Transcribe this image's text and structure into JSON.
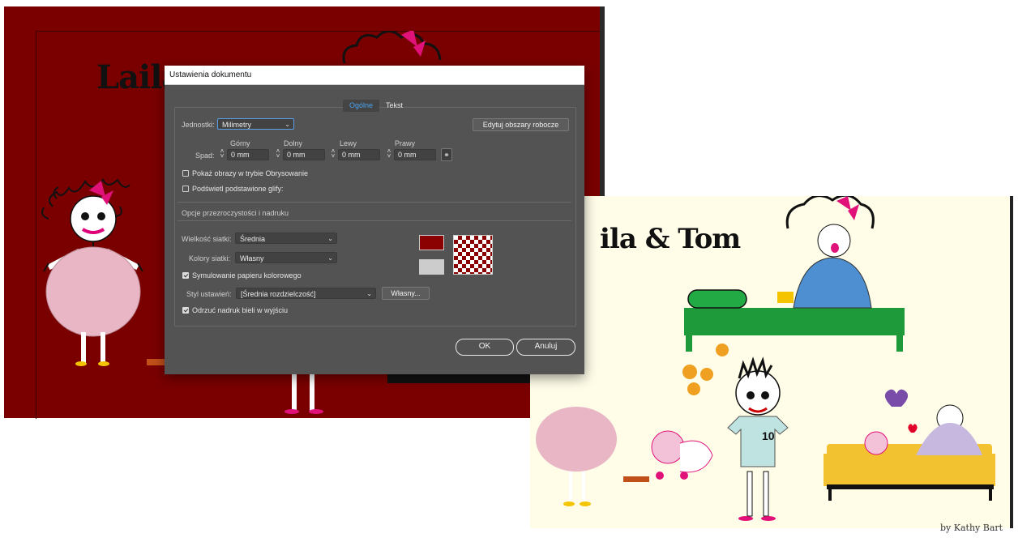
{
  "background": {
    "left_title": "Laila",
    "right_title": "ila & Tom",
    "credit": "by Kathy Bart",
    "jersey_number": "10",
    "colors": {
      "red_artboard": "#7a0000",
      "cream_artboard": "#fffde8"
    }
  },
  "dialog": {
    "title": "Ustawienia dokumentu",
    "tabs": [
      {
        "label": "Ogólne",
        "active": true
      },
      {
        "label": "Tekst",
        "active": false
      }
    ],
    "units_label": "Jednostki:",
    "units_value": "Milimetry",
    "edit_artboards_label": "Edytuj obszary robocze",
    "bleed": {
      "label": "Spad:",
      "fields": [
        {
          "label": "Górny",
          "value": "0 mm"
        },
        {
          "label": "Dolny",
          "value": "0 mm"
        },
        {
          "label": "Lewy",
          "value": "0 mm"
        },
        {
          "label": "Prawy",
          "value": "0 mm"
        }
      ]
    },
    "checkboxes": {
      "show_images_outline": {
        "label": "Pokaż obrazy w trybie Obrysowanie",
        "checked": false
      },
      "highlight_glyphs": {
        "label": "Podświetl podstawione glify:",
        "checked": false
      }
    },
    "transparency_section": "Opcje przezroczystości i nadruku",
    "grid_size_label": "Wielkość siatki:",
    "grid_size_value": "Średnia",
    "grid_colors_label": "Kolory siatki:",
    "grid_colors_value": "Własny",
    "simulate_paper": {
      "label": "Symulowanie papieru kolorowego",
      "checked": true
    },
    "preset_label": "Styl ustawień:",
    "preset_value": "[Średnia rozdzielczość]",
    "custom_button": "Własny...",
    "discard_white": {
      "label": "Odrzuć nadruk bieli w wyjściu",
      "checked": true
    },
    "swatch_colors": {
      "paper": "#8b0000",
      "grid": "#cccccc",
      "checker_a": "#8b0000",
      "checker_b": "#ffffff"
    },
    "ok_label": "OK",
    "cancel_label": "Anuluj"
  }
}
